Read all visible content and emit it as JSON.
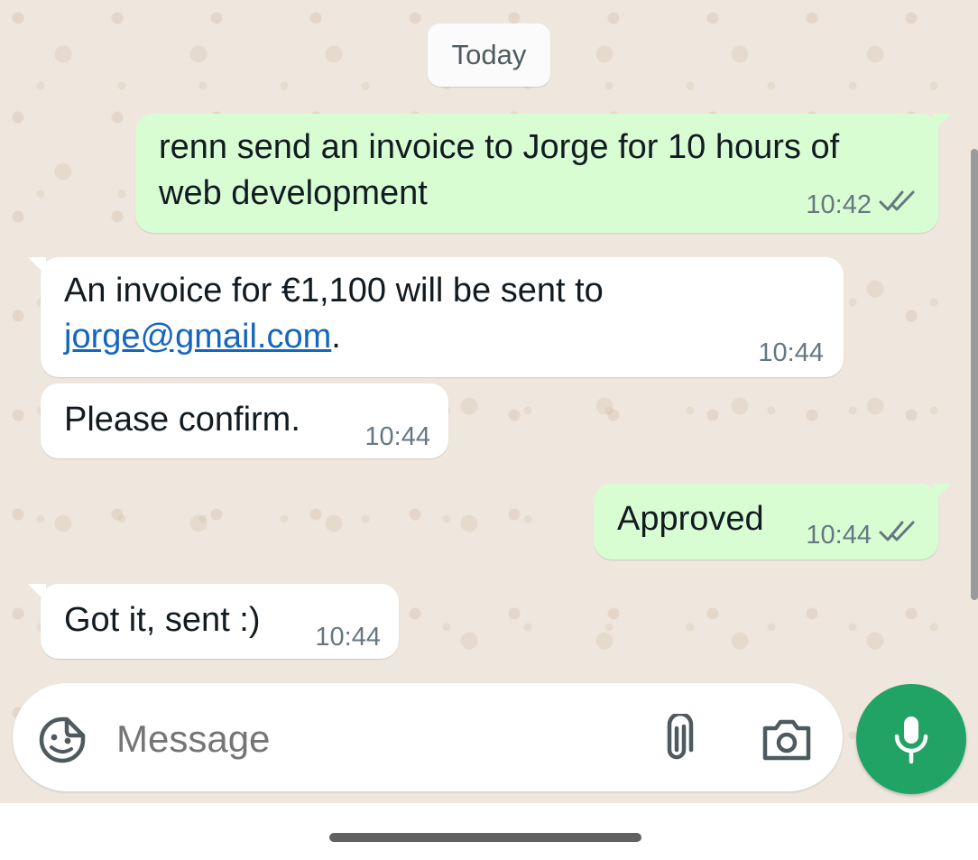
{
  "conversation": {
    "date_label": "Today",
    "messages": [
      {
        "direction": "outgoing",
        "text": "renn send an invoice to Jorge for 10 hours of\nweb development",
        "time": "10:42",
        "status": "read"
      },
      {
        "direction": "incoming",
        "text_before": "An invoice for €1,100 will be sent to\n",
        "link_text": "jorge@gmail.com",
        "text_after": ".",
        "time": "10:44"
      },
      {
        "direction": "incoming",
        "text": "Please confirm.",
        "time": "10:44"
      },
      {
        "direction": "outgoing",
        "text": "Approved",
        "time": "10:44",
        "status": "read"
      },
      {
        "direction": "incoming",
        "text": "Got it, sent :)",
        "time": "10:44"
      }
    ]
  },
  "composer": {
    "placeholder": "Message",
    "icons": {
      "emoji": "sticker-emoji-icon",
      "attach": "paperclip-icon",
      "camera": "camera-icon",
      "send": "microphone-icon"
    }
  },
  "colors": {
    "wallpaper": "#efe7de",
    "outgoing_bubble": "#d9fdd3",
    "incoming_bubble": "#ffffff",
    "link": "#1565c0",
    "accent": "#21a366",
    "timestamp": "#667781"
  }
}
